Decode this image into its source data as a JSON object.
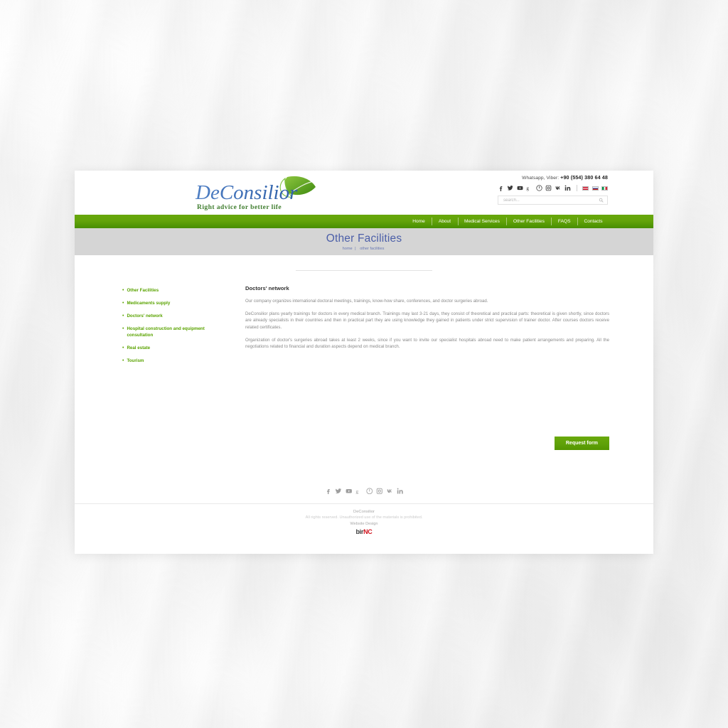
{
  "header": {
    "logo": {
      "name": "DeConsilior",
      "tagline": "Right advice for better life"
    },
    "contact_prefix": "Whatsapp, Viber:",
    "phone": "+90 (554) 380 64 48",
    "social": [
      {
        "name": "facebook-icon",
        "glyph": "f"
      },
      {
        "name": "twitter-icon",
        "glyph": "t"
      },
      {
        "name": "youtube-icon",
        "glyph": "y"
      },
      {
        "name": "google-plus-icon",
        "glyph": "g"
      },
      {
        "name": "pinterest-icon",
        "glyph": "p"
      },
      {
        "name": "instagram-icon",
        "glyph": "i"
      },
      {
        "name": "vk-icon",
        "glyph": "v"
      },
      {
        "name": "linkedin-icon",
        "glyph": "in"
      }
    ],
    "languages": [
      {
        "name": "flag-en",
        "label": "English"
      },
      {
        "name": "flag-ru",
        "label": "Russian"
      },
      {
        "name": "flag-it",
        "label": "Italian"
      }
    ],
    "search": {
      "placeholder": "search...",
      "value": "",
      "icon": "search-icon"
    }
  },
  "nav": {
    "items": [
      {
        "label": "Home",
        "active": false
      },
      {
        "label": "About",
        "active": false
      },
      {
        "label": "Medical Services",
        "active": false
      },
      {
        "label": "Other Facilities",
        "active": true
      },
      {
        "label": "FAQS",
        "active": false
      },
      {
        "label": "Contacts",
        "active": false
      }
    ]
  },
  "banner": {
    "title": "Other Facilities",
    "breadcrumb_home": "home",
    "breadcrumb_sep": "|",
    "breadcrumb_current": "other facilities"
  },
  "sidebar": {
    "items": [
      {
        "label": "Other Facilities"
      },
      {
        "label": "Medicaments supply"
      },
      {
        "label": "Doctors' network"
      },
      {
        "label": "Hospital construction and equipment consultation"
      },
      {
        "label": "Real estate"
      },
      {
        "label": "Tourism"
      }
    ]
  },
  "main": {
    "heading": "Doctors' network",
    "paragraphs": [
      "Our company organizes international doctoral meetings, trainings, know-how share, conferences, and doctor surgeries abroad.",
      "DeConsilior plans yearly trainings for doctors in every medical branch. Trainings may last 3-21 days, they consist of theoretical and practical parts: theoretical is given shortly, since doctors are already specialists in their countries and then in practical part they are using knowledge they gained in patients under strict supervision of trainer doctor. After courses doctors receive related certificates.",
      "Organization of doctor's surgeries abroad takes at least 2 weeks, since if you want to invite our specialist hospitals abroad need to make patient arrangements and preparing.  All the negotiations related to financial and duration aspects depend on medical branch."
    ],
    "request_button": "Request form"
  },
  "footer": {
    "social": [
      {
        "name": "facebook-icon"
      },
      {
        "name": "twitter-icon"
      },
      {
        "name": "youtube-icon"
      },
      {
        "name": "google-plus-icon"
      },
      {
        "name": "pinterest-icon"
      },
      {
        "name": "instagram-icon"
      },
      {
        "name": "vk-icon"
      },
      {
        "name": "linkedin-icon"
      }
    ],
    "company": "DeConsilior",
    "rights": "All rights reserved. Unauthorized use of the materials is prohibited.",
    "designed_label": "Website Design",
    "designer_part1": "bir",
    "designer_part2": "NC"
  },
  "colors": {
    "nav_green": "#63a40a",
    "accent_green": "#5aa300",
    "title_blue": "#4c5fa8",
    "banner_gray": "#d5d5d5",
    "designer_red": "#d0141e"
  }
}
